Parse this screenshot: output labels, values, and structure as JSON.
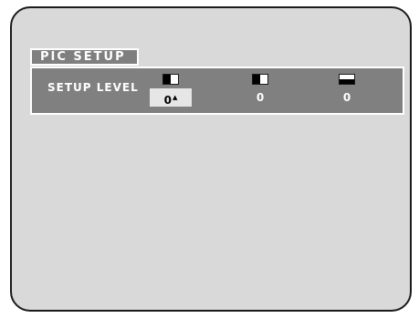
{
  "menu": {
    "title": "PIC SETUP",
    "setting_label": "SETUP LEVEL",
    "columns": [
      {
        "icon": "split-screen-vertical-icon",
        "value": "0",
        "selected": true,
        "indicator": "▲"
      },
      {
        "icon": "split-screen-vertical-icon",
        "value": "0",
        "selected": false
      },
      {
        "icon": "split-screen-horizontal-icon",
        "value": "0",
        "selected": false
      }
    ]
  },
  "colors": {
    "panel": "#808080",
    "background": "#d9d9d9",
    "highlight": "#e6e6e6",
    "text": "#ffffff"
  }
}
